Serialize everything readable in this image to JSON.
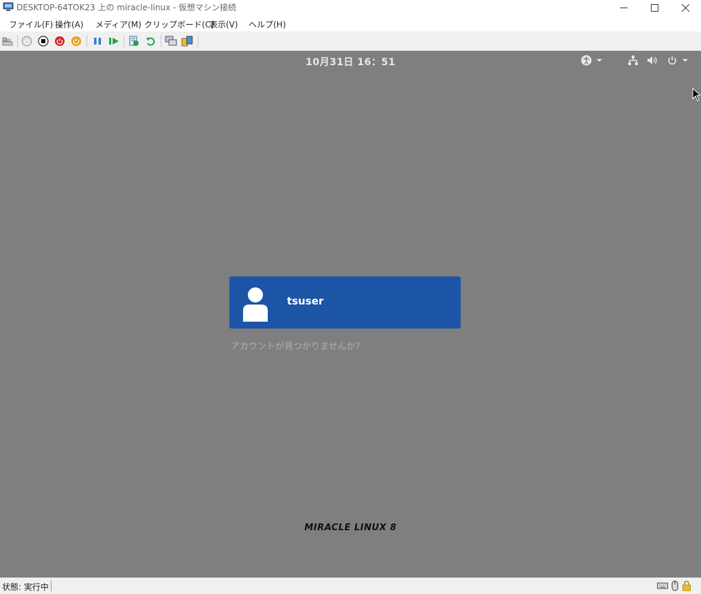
{
  "window": {
    "title": "DESKTOP-64TOK23 上の miracle-linux  - 仮想マシン接続",
    "icons": [
      "vm-connection-icon",
      "minimize-icon",
      "maximize-icon",
      "close-icon"
    ]
  },
  "menu": {
    "items": [
      "ファイル(F)",
      "操作(A)",
      "メディア(M)",
      "クリップボード(C)",
      "表示(V)",
      "ヘルプ(H)"
    ]
  },
  "toolbar": {
    "icons": [
      "ctrl-alt-del-icon",
      "start-icon",
      "turn-off-icon",
      "shut-down-icon",
      "power-orange-icon",
      "pause-icon",
      "resume-icon",
      "checkpoint-icon",
      "revert-icon",
      "enhanced-session-icon",
      "share-icon"
    ]
  },
  "vm": {
    "clock": "10月31日  16：51",
    "user": {
      "name": "tsuser"
    },
    "not_listed": "アカウントが見つかりませんか?",
    "logo": "MIRACLE LINUX 8",
    "background_color": "#7f7f7f",
    "card_color": "#1c55a5",
    "topbar_icons": [
      "accessibility-icon",
      "network-icon",
      "volume-icon",
      "power-icon"
    ]
  },
  "status": {
    "label": "状態: 実行中",
    "icons": [
      "keyboard-icon",
      "mouse-icon",
      "lock-icon"
    ]
  }
}
